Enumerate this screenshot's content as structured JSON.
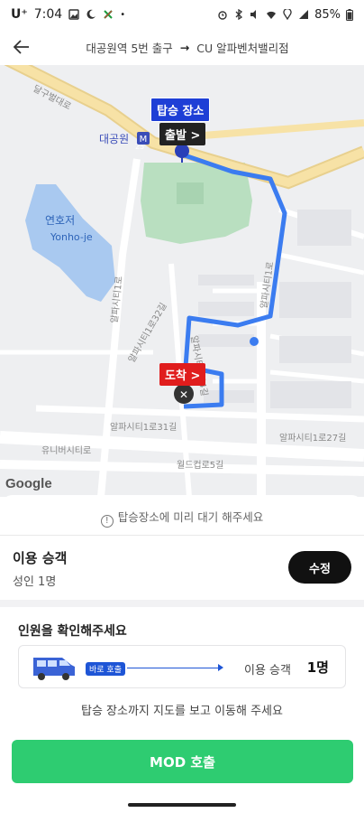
{
  "status_bar": {
    "carrier": "U⁺",
    "time": "7:04",
    "battery": "85%"
  },
  "header": {
    "origin": "대공원역 5번 출구",
    "arrow": "→",
    "destination": "CU 알파벤처밸리점"
  },
  "map": {
    "pickup_label": "탑승 장소",
    "depart_label": "출발 >",
    "arrive_label": "도착 >",
    "labels": {
      "station": "대공원",
      "station_badge": "M",
      "lake_ko": "연호저",
      "lake_en": "Yonho-je",
      "road_top": "달구벌대로",
      "road_25": "25",
      "road_vertical1": "알파시티1로",
      "road_vertical2": "알파시티1로32길",
      "road_vertical3": "알파시티1로4길",
      "road_vertical4": "알파시티1로",
      "road_alpha31": "알파시티1로31길",
      "road_alpha27": "알파시티1로27길",
      "road_univ": "유니버시티로",
      "road_world": "월드컵로5길",
      "road_east": "알파시티1로"
    },
    "google_logo": "Google",
    "colors": {
      "route": "#3b7cf0",
      "pickup": "#1e3fd6",
      "arrive": "#e01d1d",
      "park": "#b9dfc0",
      "water": "#a9c9f0",
      "highway": "#f5d98a"
    }
  },
  "sheet": {
    "notice": "탑승장소에 미리 대기 해주세요",
    "notice_icon": "!",
    "passengers_title": "이용 승객",
    "passengers_value": "성인 1명",
    "edit_button": "수정",
    "confirm_title": "인원을 확인해주세요",
    "instant_tag": "바로 호출",
    "use_label": "이용 승객",
    "use_value": "1명",
    "hint": "탑승 장소까지 지도를 보고 이동해 주세요",
    "call_button": "MOD 호출"
  }
}
